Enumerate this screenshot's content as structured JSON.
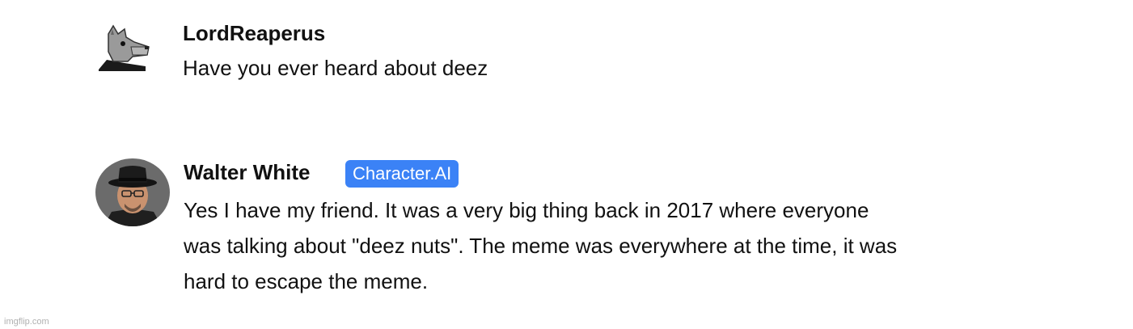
{
  "messages": [
    {
      "author": "LordReaperus",
      "avatar_icon": "wolf-avatar-icon",
      "lines": [
        "Have you ever heard about deez"
      ]
    },
    {
      "author": "Walter White",
      "badge": "Character.AI",
      "avatar_icon": "walter-white-avatar-icon",
      "lines": [
        "Yes I have my friend. It was a very big thing back in 2017 where everyone",
        "was talking about \"deez nuts\". The meme was everywhere at the time, it was",
        "hard to escape the meme."
      ]
    }
  ],
  "colors": {
    "badge_bg": "#3b82f6",
    "text": "#111111",
    "watermark": "#b0b0b0"
  },
  "watermark": "imgflip.com"
}
